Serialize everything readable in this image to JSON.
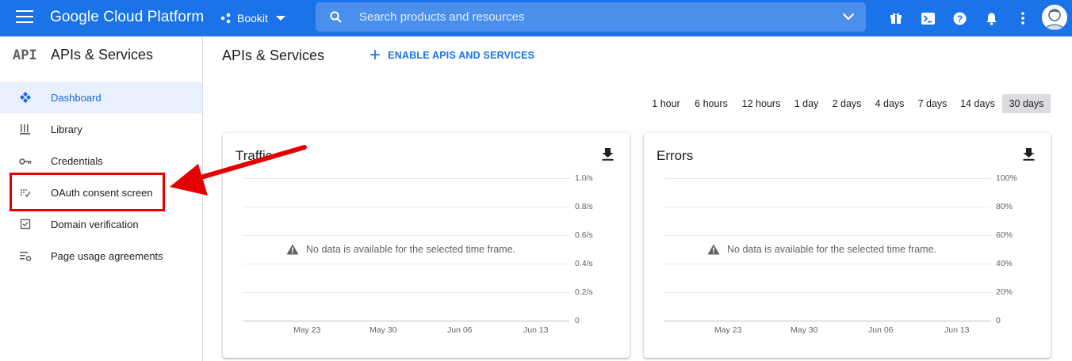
{
  "header": {
    "brand": "Google Cloud Platform",
    "project": "Bookit",
    "search_placeholder": "Search products and resources",
    "accent_color": "#1a73e8",
    "icons": [
      "gift-icon",
      "cloud-shell-icon",
      "help-icon",
      "notifications-icon",
      "more-vert-icon",
      "account-avatar"
    ]
  },
  "sidebar": {
    "logo": "API",
    "title": "APIs & Services",
    "items": [
      {
        "label": "Dashboard",
        "icon": "dashboard-icon",
        "active": true
      },
      {
        "label": "Library",
        "icon": "library-icon",
        "active": false
      },
      {
        "label": "Credentials",
        "icon": "key-icon",
        "active": false
      },
      {
        "label": "OAuth consent screen",
        "icon": "oauth-icon",
        "active": false
      },
      {
        "label": "Domain verification",
        "icon": "check-box-icon",
        "active": false
      },
      {
        "label": "Page usage agreements",
        "icon": "settings-list-icon",
        "active": false
      }
    ]
  },
  "main": {
    "title": "APIs & Services",
    "enable_label": "ENABLE APIS AND SERVICES",
    "time_ranges": [
      "1 hour",
      "6 hours",
      "12 hours",
      "1 day",
      "2 days",
      "4 days",
      "7 days",
      "14 days",
      "30 days"
    ],
    "selected_range": "30 days"
  },
  "cards": [
    {
      "title": "Traffic",
      "y_ticks": [
        "1.0/s",
        "0.8/s",
        "0.6/s",
        "0.4/s",
        "0.2/s",
        "0"
      ],
      "x_ticks": [
        "May 23",
        "May 30",
        "Jun 06",
        "Jun 13"
      ],
      "no_data": "No data is available for the selected time frame."
    },
    {
      "title": "Errors",
      "y_ticks": [
        "100%",
        "80%",
        "60%",
        "40%",
        "20%",
        "0"
      ],
      "x_ticks": [
        "May 23",
        "May 30",
        "Jun 06",
        "Jun 13"
      ],
      "no_data": "No data is available for the selected time frame."
    }
  ],
  "annotation": {
    "highlight_color": "#e50000",
    "target": "OAuth consent screen"
  }
}
